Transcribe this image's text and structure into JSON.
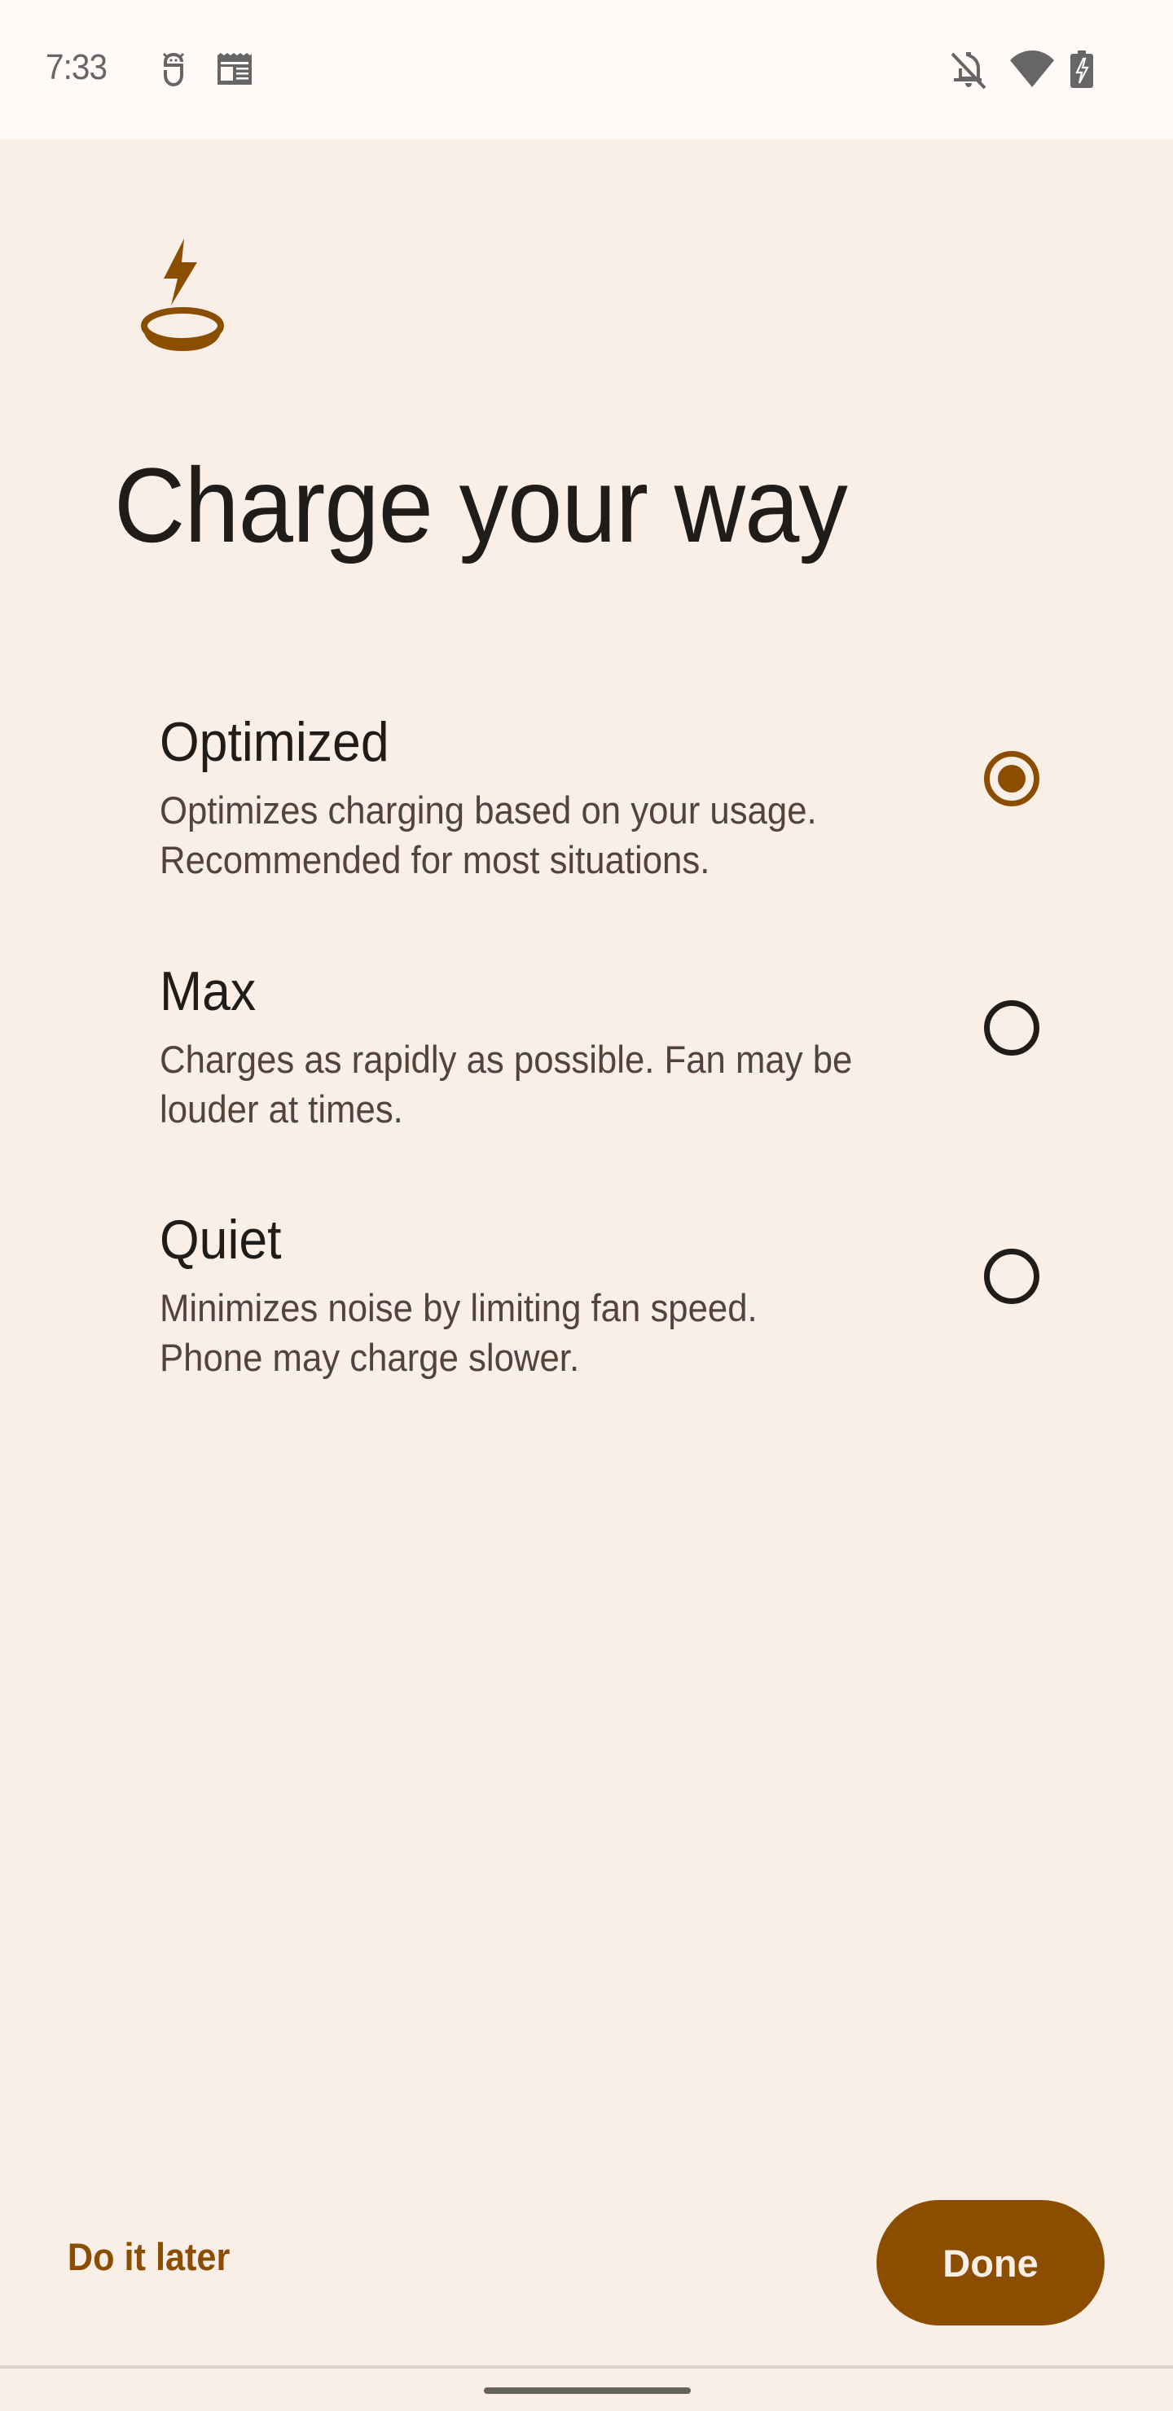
{
  "status_bar": {
    "time": "7:33",
    "left_icons": [
      "sim-toolkit-icon",
      "news-icon"
    ],
    "right_icons": [
      "notifications-off-icon",
      "wifi-icon",
      "battery-charging-icon"
    ]
  },
  "hero": {
    "icon": "wireless-charging-icon",
    "title": "Charge your way"
  },
  "options": [
    {
      "title": "Optimized",
      "description": "Optimizes charging based on your usage.\nRecommended for most situations.",
      "selected": true
    },
    {
      "title": "Max",
      "description": "Charges as rapidly as possible. Fan may be\nlouder at times.",
      "selected": false
    },
    {
      "title": "Quiet",
      "description": "Minimizes noise by limiting fan speed.\nPhone may charge slower.",
      "selected": false
    }
  ],
  "footer": {
    "secondary_label": "Do it later",
    "primary_label": "Done"
  },
  "colors": {
    "accent": "#8b4e00",
    "background": "#f9efe7",
    "status_bar": "#fffaf7",
    "text_primary": "#201c19",
    "text_secondary": "#52443a"
  }
}
